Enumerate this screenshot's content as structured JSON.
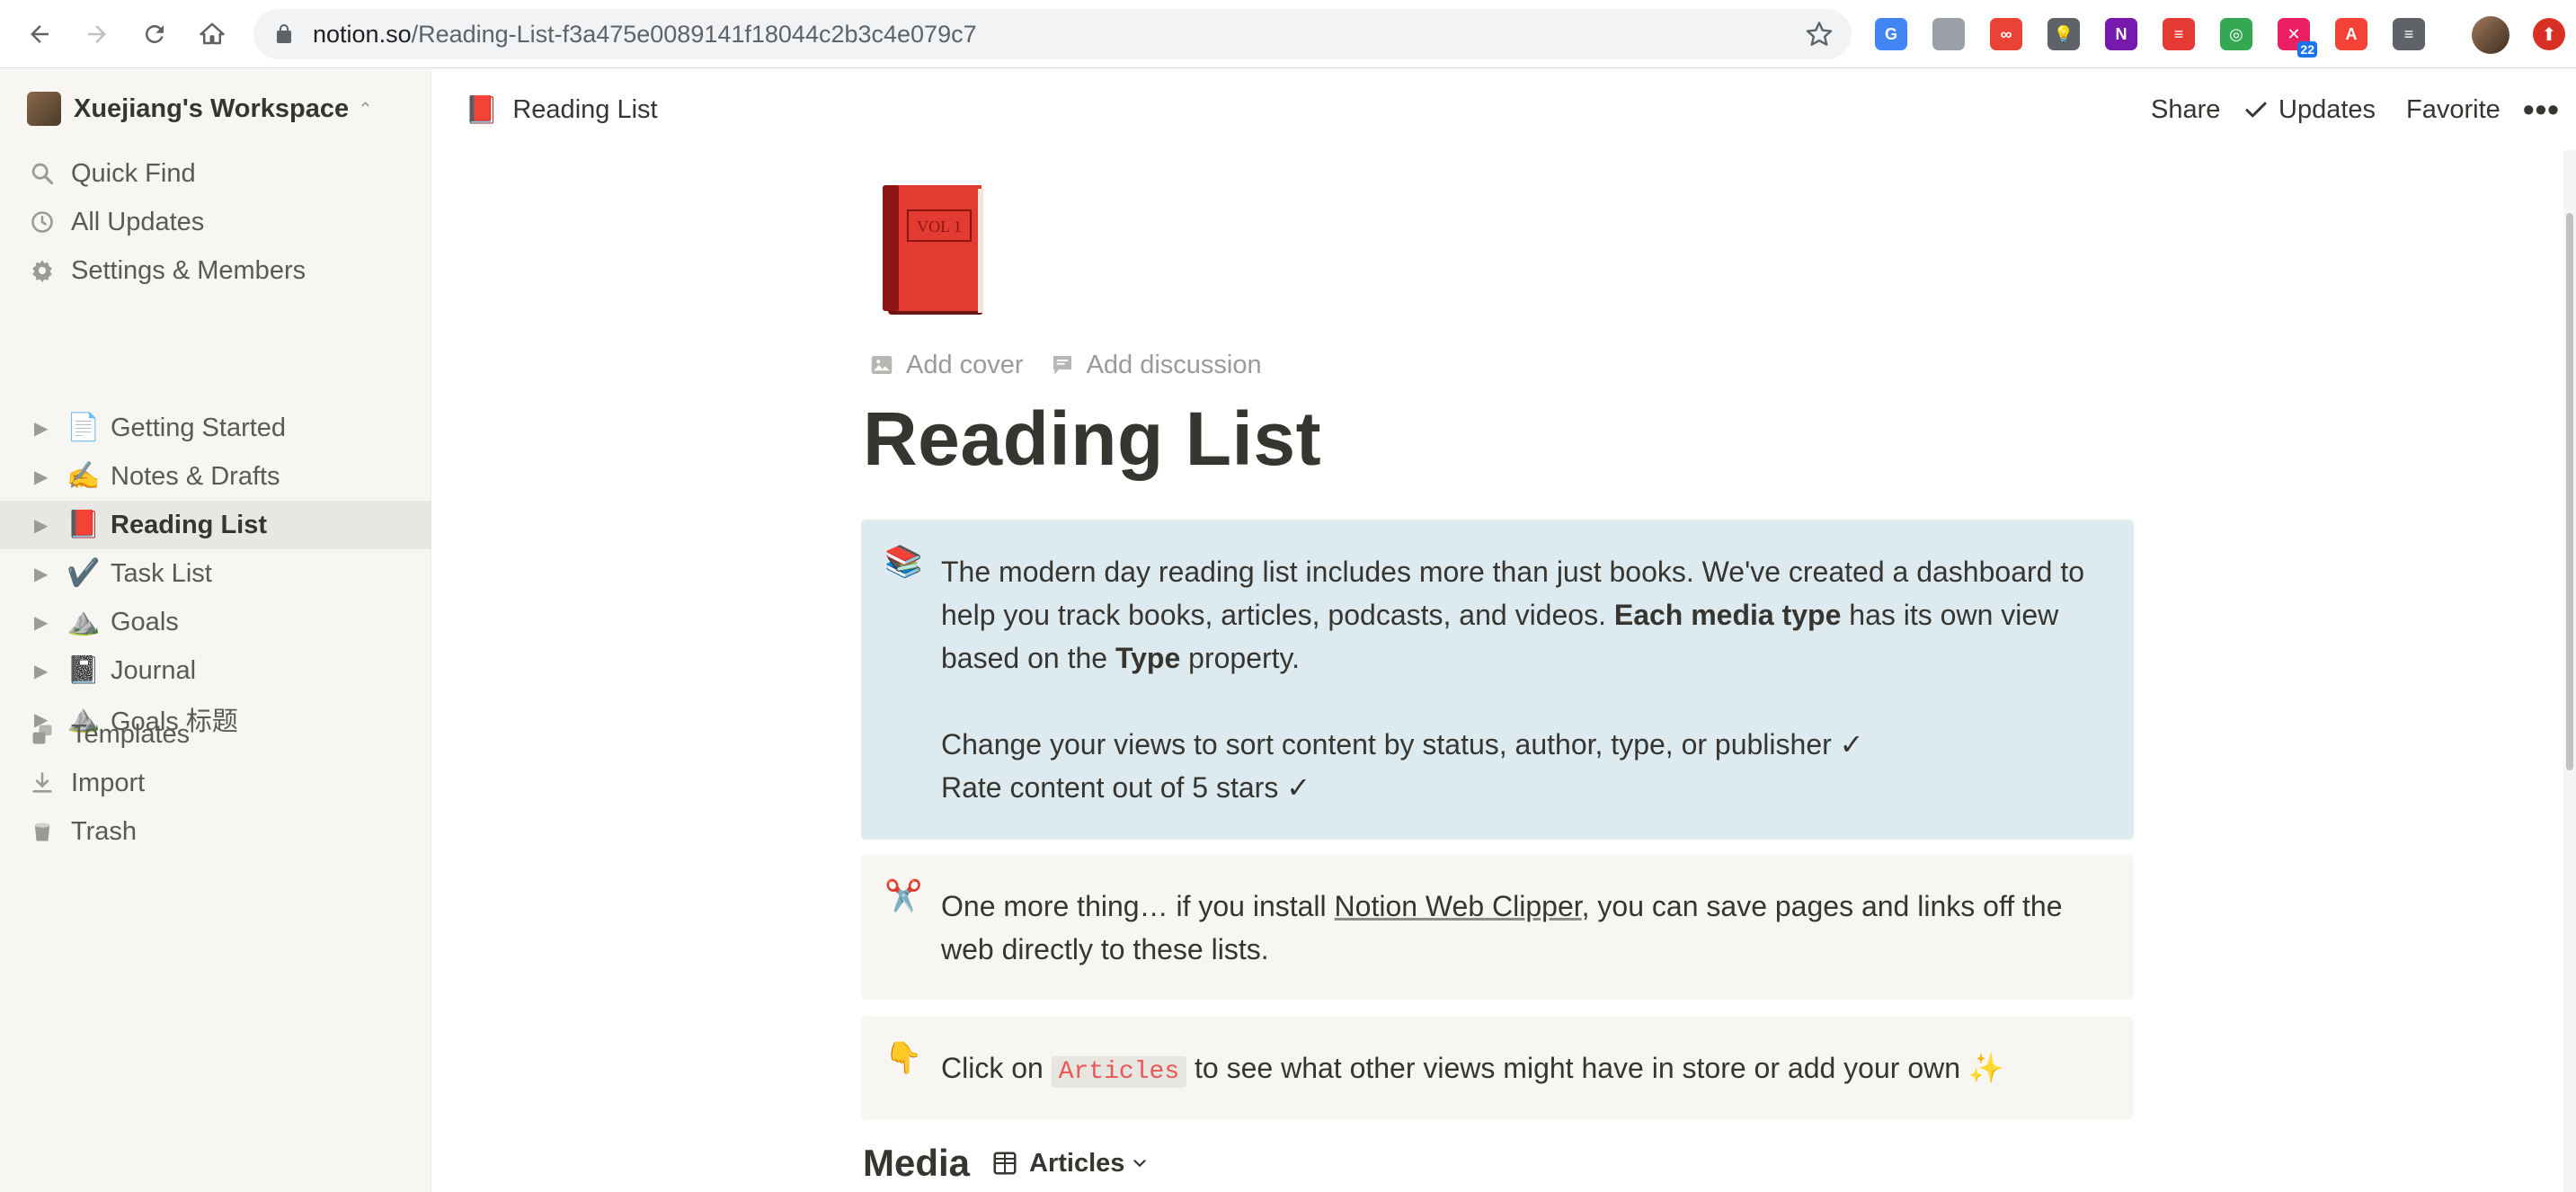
{
  "browser": {
    "url_host": "notion.so",
    "url_path": "/Reading-List-f3a475e0089141f18044c2b3c4e079c7",
    "extensions": [
      {
        "name": "google-translate-icon",
        "color": "#4285f4",
        "glyph": "G"
      },
      {
        "name": "camera-icon",
        "color": "#9aa0a6",
        "glyph": ""
      },
      {
        "name": "infinity-icon",
        "color": "#ea4335",
        "glyph": "∞"
      },
      {
        "name": "lightbulb-icon",
        "color": "#5f6368",
        "glyph": "💡"
      },
      {
        "name": "onenote-icon",
        "color": "#7719aa",
        "glyph": "N"
      },
      {
        "name": "notes-icon",
        "color": "#e53935",
        "glyph": "≡"
      },
      {
        "name": "compass-icon",
        "color": "#34a853",
        "glyph": "◎"
      },
      {
        "name": "calendar-icon",
        "color": "#e91e63",
        "glyph": "✕",
        "badge": "22"
      },
      {
        "name": "acrobat-icon",
        "color": "#f44336",
        "glyph": "A"
      },
      {
        "name": "reading-list-icon",
        "color": "#5f6368",
        "glyph": "≡"
      }
    ]
  },
  "sidebar": {
    "workspace_name": "Xuejiang's Workspace",
    "top_items": [
      {
        "label": "Quick Find",
        "icon": "search-icon"
      },
      {
        "label": "All Updates",
        "icon": "clock-icon"
      },
      {
        "label": "Settings & Members",
        "icon": "gear-icon"
      }
    ],
    "pages": [
      {
        "label": "Getting Started",
        "emoji": "📄"
      },
      {
        "label": "Notes & Drafts",
        "emoji": "✍️"
      },
      {
        "label": "Reading List",
        "emoji": "📕",
        "active": true
      },
      {
        "label": "Task List",
        "emoji": "✔️"
      },
      {
        "label": "Goals",
        "emoji": "⛰️"
      },
      {
        "label": "Journal",
        "emoji": "📓"
      },
      {
        "label": "Goals 标题",
        "emoji": "⛰️"
      }
    ],
    "bottom_items": [
      {
        "label": "Templates",
        "icon": "templates-icon"
      },
      {
        "label": "Import",
        "icon": "import-icon"
      },
      {
        "label": "Trash",
        "icon": "trash-icon"
      }
    ]
  },
  "topbar": {
    "breadcrumb_emoji": "📕",
    "breadcrumb_label": "Reading List",
    "share_label": "Share",
    "updates_label": "Updates",
    "favorite_label": "Favorite"
  },
  "page": {
    "add_cover_label": "Add cover",
    "add_discussion_label": "Add discussion",
    "title": "Reading List",
    "callout_1": {
      "emoji": "📚",
      "text_a": "The modern day reading list includes more than just books. We've created a dashboard to help you track books, articles, podcasts, and videos. ",
      "bold_a": "Each media type",
      "text_b": " has its own view based on the ",
      "bold_b": "Type",
      "text_c": " property.",
      "line_2": "Change your views to sort content by status, author, type, or publisher ✓",
      "line_3": "Rate content out of 5 stars ✓"
    },
    "callout_2": {
      "emoji": "✂️",
      "text_a": "One more thing… if you install ",
      "link": "Notion Web Clipper",
      "text_b": ", you can save pages and links off the web directly to these lists."
    },
    "callout_3": {
      "emoji": "👇",
      "text_a": "Click on ",
      "code": "Articles",
      "text_b": " to see what other views might have in store or add your own ✨"
    },
    "database": {
      "title": "Media",
      "view_label": "Articles"
    }
  }
}
